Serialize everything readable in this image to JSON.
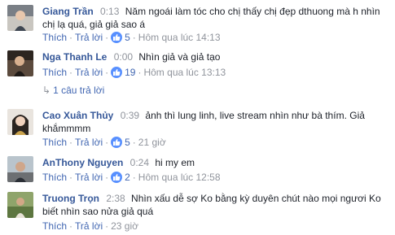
{
  "colors": {
    "link": "#365899",
    "action": "#4267b2",
    "meta": "#90949c",
    "like_badge": "#5890ff"
  },
  "comments": [
    {
      "author": "Giang Trần",
      "timestamp": "0:13",
      "text": "Năm ngoái làm tóc cho chị thấy chị đẹp dthuong mà h nhìn chị lạ quá, giả giả sao á",
      "like_label": "Thích",
      "reply_label": "Trả lời",
      "like_count": "5",
      "time": "Hôm qua lúc 14:13",
      "avatar_icon": "user-avatar-icon"
    },
    {
      "author": "Nga Thanh Le",
      "timestamp": "0:00",
      "text": "Nhìn giả và giả tạo",
      "like_label": "Thích",
      "reply_label": "Trả lời",
      "like_count": "19",
      "time": "Hôm qua lúc 13:13",
      "replies_link": "1 câu trả lời",
      "avatar_icon": "user-avatar-icon"
    },
    {
      "author": "Cao Xuân Thủy",
      "timestamp": "0:39",
      "text": "ảnh thì lung linh, live stream nhìn như bà thím. Giả khắmmmm",
      "like_label": "Thích",
      "reply_label": "Trả lời",
      "like_count": "5",
      "time": "21 giờ",
      "avatar_icon": "user-avatar-icon"
    },
    {
      "author": "AnThony Nguyen",
      "timestamp": "0:24",
      "text": "hi my em",
      "like_label": "Thích",
      "reply_label": "Trả lời",
      "like_count": "2",
      "time": "Hôm qua lúc 12:58",
      "avatar_icon": "user-avatar-icon"
    },
    {
      "author": "Truong Trọn",
      "timestamp": "2:38",
      "text": "Nhìn xấu dễ sợ Ko bằng kỳ duyên chút nào mọi ngươi Ko biết nhìn sao nửa giả quá",
      "like_label": "Thích",
      "reply_label": "Trả lời",
      "like_count": "",
      "time": "23 giờ",
      "avatar_icon": "user-avatar-icon"
    }
  ]
}
